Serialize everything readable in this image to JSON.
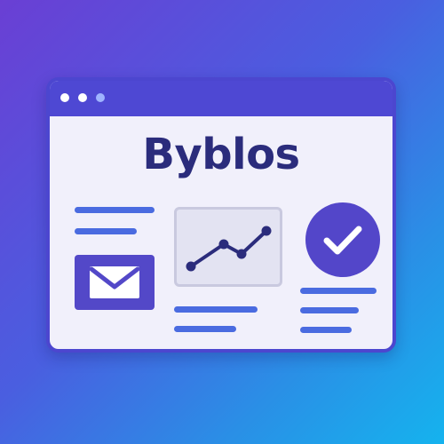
{
  "app": {
    "title": "Byblos"
  },
  "window": {
    "controls": [
      "close",
      "minimize",
      "maximize"
    ]
  },
  "icons": {
    "mail": "envelope-icon",
    "chart": "line-chart-icon",
    "check": "checkmark-icon"
  },
  "colors": {
    "frame": "#4e48d3",
    "title_text": "#2b2c7c",
    "accent": "#5346c9",
    "text_lines": "#4a6be0",
    "content_bg": "#f1f0fb"
  }
}
